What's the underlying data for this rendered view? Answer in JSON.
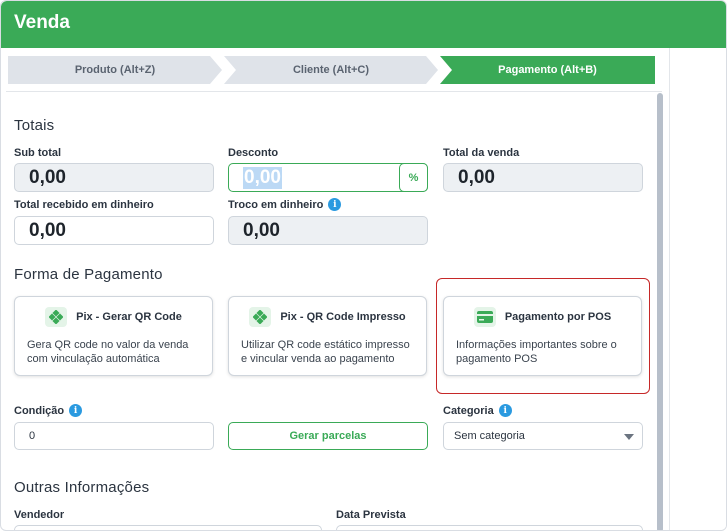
{
  "header": {
    "title": "Venda"
  },
  "steps": [
    {
      "label": "Produto (Alt+Z)",
      "active": false
    },
    {
      "label": "Cliente (Alt+C)",
      "active": false
    },
    {
      "label": "Pagamento (Alt+B)",
      "active": true
    }
  ],
  "totais": {
    "title": "Totais",
    "subtotal_label": "Sub total",
    "subtotal_value": "0,00",
    "desconto_label": "Desconto",
    "desconto_value": "0,00",
    "desconto_toggle": "%",
    "total_label": "Total da venda",
    "total_value": "0,00",
    "recebido_label": "Total recebido em dinheiro",
    "recebido_value": "0,00",
    "troco_label": "Troco em dinheiro",
    "troco_value": "0,00"
  },
  "pagamento": {
    "title": "Forma de Pagamento",
    "options": [
      {
        "title": "Pix - Gerar QR Code",
        "desc": "Gera QR code no valor da venda com vinculação automática",
        "icon": "pix-icon"
      },
      {
        "title": "Pix - QR Code Impresso",
        "desc": "Utilizar QR code estático impresso e vincular venda ao pagamento",
        "icon": "pix-icon"
      },
      {
        "title": "Pagamento por POS",
        "desc": "Informações importantes sobre o pagamento POS",
        "icon": "card-icon",
        "selected": true
      }
    ]
  },
  "condicao": {
    "label": "Condição",
    "value": "0",
    "gerar_label": "Gerar parcelas"
  },
  "categoria": {
    "label": "Categoria",
    "value": "Sem categoria"
  },
  "outras": {
    "title": "Outras Informações",
    "vendedor_label": "Vendedor",
    "data_label": "Data Prevista"
  },
  "colors": {
    "brand": "#3aaa57",
    "selected_outline": "#c62828",
    "info": "#2b9ae0"
  }
}
